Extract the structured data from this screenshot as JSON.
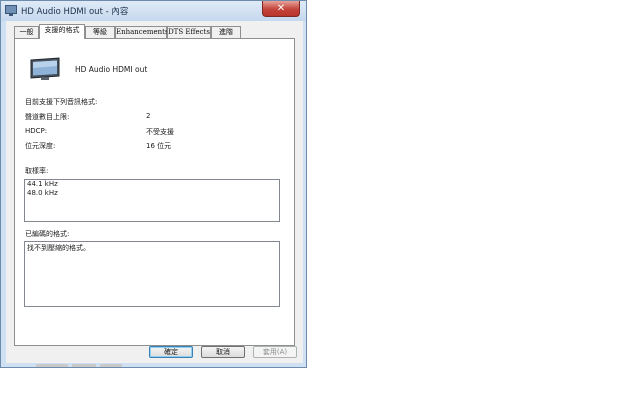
{
  "window": {
    "title": "HD Audio HDMI out - 內容",
    "close_symbol": "✕"
  },
  "tabs": [
    {
      "label": "一般"
    },
    {
      "label": "支援的格式"
    },
    {
      "label": "等級"
    },
    {
      "label": "Enhancements"
    },
    {
      "label": "DTS Effects"
    },
    {
      "label": "進階"
    }
  ],
  "active_tab": 1,
  "device": {
    "name": "HD Audio HDMI out",
    "icon": "monitor-icon"
  },
  "supported_formats": {
    "heading": "目前支援下列音訊格式:",
    "rows": [
      {
        "label": "聲道數目上限:",
        "value": "2"
      },
      {
        "label": "HDCP:",
        "value": "不受支援"
      },
      {
        "label": "位元深度:",
        "value": "16 位元"
      }
    ]
  },
  "sample_rates": {
    "label": "取樣率:",
    "items": [
      "44.1 kHz",
      "48.0 kHz"
    ]
  },
  "encoded_formats": {
    "label": "已編碼的格式:",
    "items": [
      "找不到壓縮的格式。"
    ]
  },
  "buttons": {
    "ok": "確定",
    "cancel": "取消",
    "apply": "套用(A)"
  },
  "colors": {
    "title_bar": "#c5d8ee",
    "close_button": "#c3443a",
    "default_button_border": "#3c7fb1"
  }
}
